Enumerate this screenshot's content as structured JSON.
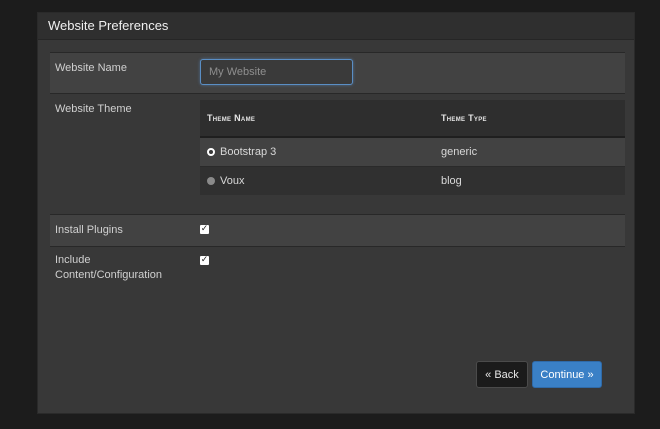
{
  "panel": {
    "title": "Website Preferences"
  },
  "website_name": {
    "label": "Website Name",
    "value": "",
    "placeholder": "My Website"
  },
  "website_theme": {
    "label": "Website Theme",
    "columns": [
      "Theme Name",
      "Theme Type"
    ],
    "rows": [
      {
        "name": "Bootstrap 3",
        "type": "generic",
        "selected": true
      },
      {
        "name": "Voux",
        "type": "blog",
        "selected": false
      }
    ]
  },
  "install_plugins": {
    "label": "Install Plugins",
    "checked": true
  },
  "include_content": {
    "label_line1": "Include",
    "label_line2": "Content/Configuration",
    "checked": true
  },
  "buttons": {
    "back_label": "« Back",
    "continue_label": "Continue »"
  },
  "colors": {
    "accent": "#3a80c6",
    "panel_bg": "#383838",
    "page_bg": "#1c1c1c"
  },
  "icons": {
    "checkbox_checked": "check-icon",
    "radio_selected": "radio-selected-icon",
    "radio_unselected": "radio-unselected-icon"
  }
}
